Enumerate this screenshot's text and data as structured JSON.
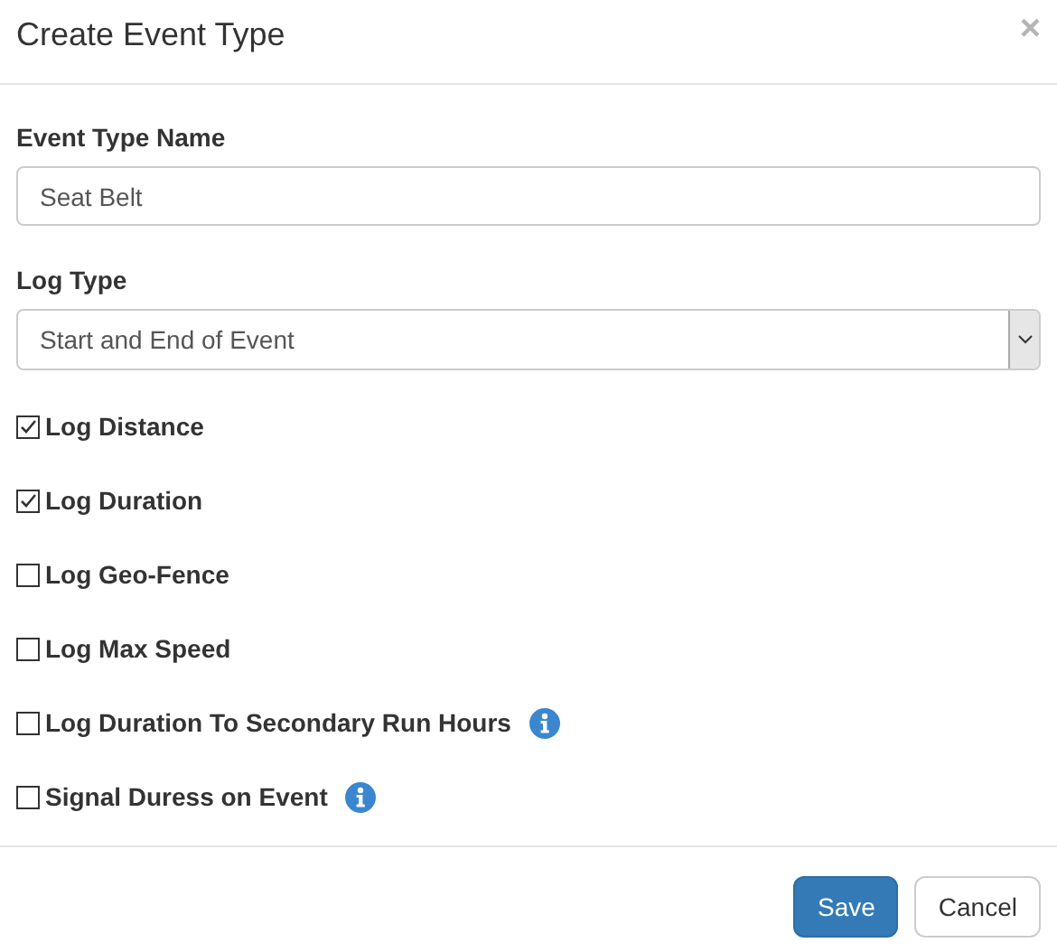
{
  "dialog": {
    "title": "Create Event Type",
    "close": "×"
  },
  "fields": [
    {
      "kind": "text",
      "label": "Event Type Name",
      "value": "Seat Belt"
    },
    {
      "kind": "select",
      "label": "Log Type",
      "value": "Start and End of Event"
    }
  ],
  "options": [
    {
      "label": "Log Distance",
      "checked": true,
      "info": false
    },
    {
      "label": "Log Duration",
      "checked": true,
      "info": false
    },
    {
      "label": "Log Geo-Fence",
      "checked": false,
      "info": false
    },
    {
      "label": "Log Max Speed",
      "checked": false,
      "info": false
    },
    {
      "label": "Log Duration To Secondary Run Hours",
      "checked": false,
      "info": true
    },
    {
      "label": "Signal Duress on Event",
      "checked": false,
      "info": true
    }
  ],
  "buttons": [
    {
      "label": "Save",
      "kind": "primary"
    },
    {
      "label": "Cancel",
      "kind": "secondary"
    }
  ]
}
